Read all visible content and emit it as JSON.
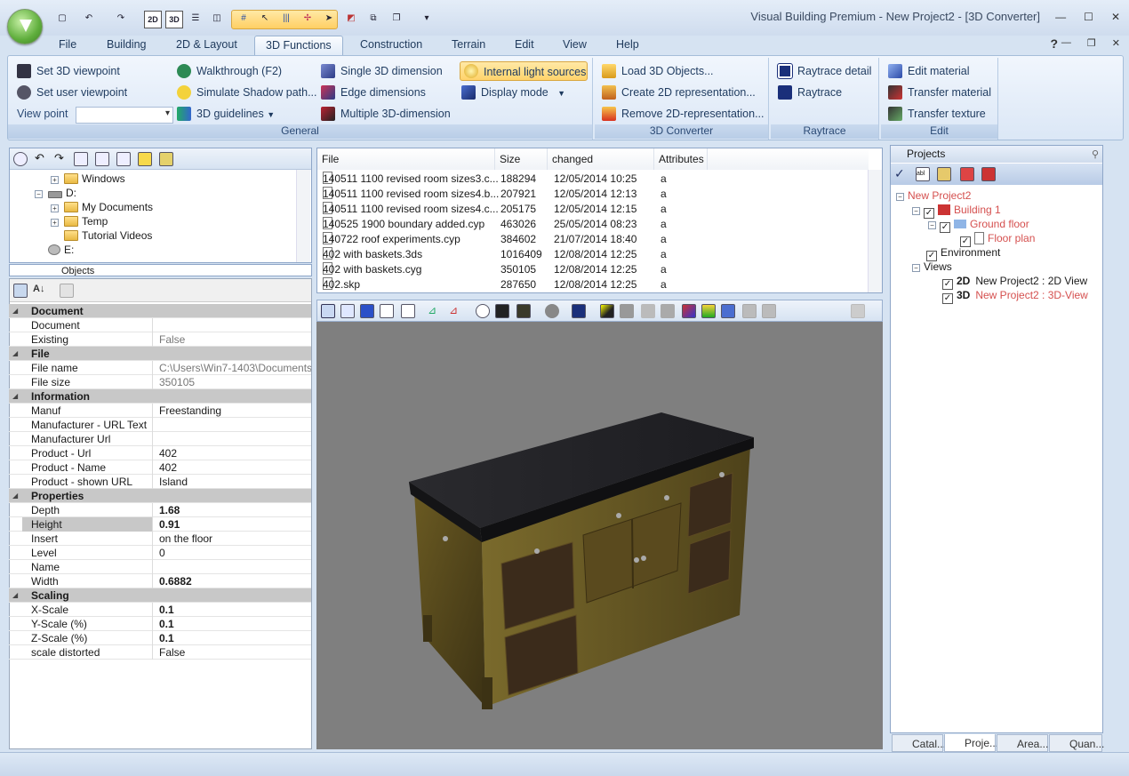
{
  "app": {
    "title": "Visual Building Premium - New Project2 - [3D Converter]"
  },
  "quick_access": {
    "icons": [
      "new-doc-icon",
      "undo-icon",
      "redo-icon",
      "2d-icon",
      "3d-icon",
      "view-split-icon",
      "view-split2-icon",
      "grid-icon",
      "select-icon",
      "columns-icon",
      "snap-icon",
      "pointer-icon",
      "measure-icon",
      "layers-icon",
      "more-icon"
    ]
  },
  "menu_tabs": [
    "File",
    "Building",
    "2D & Layout",
    "3D Functions",
    "Construction",
    "Terrain",
    "Edit",
    "View",
    "Help"
  ],
  "active_tab": "3D Functions",
  "ribbon": {
    "general": {
      "label": "General",
      "set_3d_viewpoint": "Set 3D viewpoint",
      "set_user_viewpoint": "Set user viewpoint",
      "view_point_label": "View point",
      "walkthrough": "Walkthrough (F2)",
      "simulate_shadow": "Simulate Shadow path...",
      "guidelines": "3D guidelines",
      "single_dim": "Single 3D dimension",
      "edge_dim": "Edge dimensions",
      "multiple_dim": "Multiple 3D-dimension",
      "internal_light": "Internal light sources",
      "display_mode": "Display mode"
    },
    "converter": {
      "label": "3D Converter",
      "load": "Load 3D Objects...",
      "create_2d": "Create 2D representation...",
      "remove_2d": "Remove 2D-representation..."
    },
    "raytrace": {
      "label": "Raytrace",
      "detail": "Raytrace detail",
      "raytrace": "Raytrace"
    },
    "edit": {
      "label": "Edit",
      "edit_material": "Edit material",
      "transfer_material": "Transfer material",
      "transfer_texture": "Transfer texture"
    }
  },
  "folder_tree": {
    "items": [
      {
        "label": "Windows"
      },
      {
        "label": "D:"
      },
      {
        "label": "My Documents"
      },
      {
        "label": "Temp"
      },
      {
        "label": "Tutorial Videos"
      },
      {
        "label": "E:"
      }
    ],
    "objects_label": "Objects"
  },
  "file_list": {
    "headers": [
      "File",
      "Size",
      "changed",
      "Attributes"
    ],
    "rows": [
      {
        "name": "140511 1100 revised room sizes3.c...",
        "size": "188294",
        "changed": "12/05/2014 10:25",
        "attr": "a"
      },
      {
        "name": "140511 1100 revised room sizes4.b...",
        "size": "207921",
        "changed": "12/05/2014 12:13",
        "attr": "a"
      },
      {
        "name": "140511 1100 revised room sizes4.c...",
        "size": "205175",
        "changed": "12/05/2014 12:15",
        "attr": "a"
      },
      {
        "name": "140525 1900 boundary added.cyp",
        "size": "463026",
        "changed": "25/05/2014 08:23",
        "attr": "a"
      },
      {
        "name": "140722  roof experiments.cyp",
        "size": "384602",
        "changed": "21/07/2014 18:40",
        "attr": "a"
      },
      {
        "name": "402 with baskets.3ds",
        "size": "1016409",
        "changed": "12/08/2014 12:25",
        "attr": "a"
      },
      {
        "name": "402 with baskets.cyg",
        "size": "350105",
        "changed": "12/08/2014 12:25",
        "attr": "a"
      },
      {
        "name": "402.skp",
        "size": "287650",
        "changed": "12/08/2014 12:25",
        "attr": "a"
      }
    ]
  },
  "properties": {
    "rows": [
      {
        "type": "cat",
        "k": "Document"
      },
      {
        "k": "Document",
        "v": ""
      },
      {
        "k": "Existing",
        "v": "False",
        "gray": true
      },
      {
        "type": "cat",
        "k": "File"
      },
      {
        "k": "File name",
        "v": "C:\\Users\\Win7-1403\\Documents\\Vis",
        "gray": true
      },
      {
        "k": "File size",
        "v": "350105",
        "gray": true
      },
      {
        "type": "cat",
        "k": "Information"
      },
      {
        "k": "Manuf",
        "v": "Freestanding"
      },
      {
        "k": "Manufacturer -  URL Text",
        "v": ""
      },
      {
        "k": "Manufacturer Url",
        "v": ""
      },
      {
        "k": "Product -  Url",
        "v": "402"
      },
      {
        "k": "Product - Name",
        "v": "402"
      },
      {
        "k": "Product - shown URL",
        "v": "Island"
      },
      {
        "type": "cat",
        "k": "Properties"
      },
      {
        "k": "Depth",
        "v": "1.68",
        "bold": true
      },
      {
        "k": "Height",
        "v": "0.91",
        "bold": true,
        "sel": true
      },
      {
        "k": "Insert",
        "v": "on the floor"
      },
      {
        "k": "Level",
        "v": "0"
      },
      {
        "k": "Name",
        "v": ""
      },
      {
        "k": "Width",
        "v": "0.6882",
        "bold": true
      },
      {
        "type": "cat",
        "k": "Scaling"
      },
      {
        "k": " X-Scale",
        "v": "0.1",
        "bold": true
      },
      {
        "k": " Y-Scale (%)",
        "v": "0.1",
        "bold": true
      },
      {
        "k": " Z-Scale (%)",
        "v": "0.1",
        "bold": true
      },
      {
        "k": "scale distorted",
        "v": "False"
      }
    ]
  },
  "projects": {
    "title": "Projects",
    "tree": [
      {
        "label": "New Project2",
        "red": true
      },
      {
        "label": "Building 1",
        "red": true
      },
      {
        "label": "Ground floor",
        "red": true
      },
      {
        "label": "Floor plan",
        "red": true
      },
      {
        "label": "Environment"
      },
      {
        "label": "Views"
      },
      {
        "label": "New Project2 : 2D View",
        "tag": "2D"
      },
      {
        "label": "New Project2 : 3D-View",
        "tag": "3D",
        "red": true
      }
    ],
    "bottom_tabs": [
      "Catal...",
      "Proje...",
      "Area...",
      "Quan..."
    ]
  }
}
